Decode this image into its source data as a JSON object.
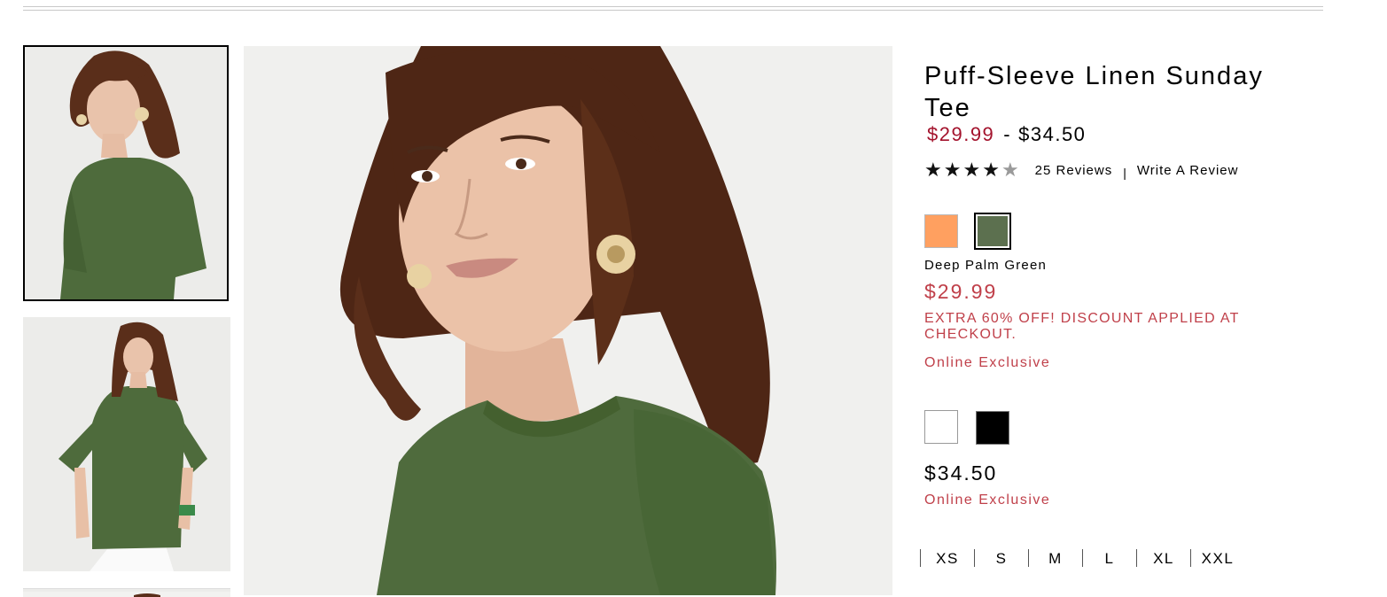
{
  "product": {
    "title": "Puff-Sleeve Linen Sunday Tee",
    "price_low": "$29.99",
    "price_dash": "-",
    "price_high": "$34.50",
    "rating": {
      "stars": 4,
      "max": 5
    },
    "reviews_label": "25 Reviews",
    "separator": "|",
    "write_review_label": "Write A Review"
  },
  "gallery": {
    "thumbnails": [
      "model-closeup",
      "model-full-body",
      "model-partial"
    ],
    "main": "model-closeup-large"
  },
  "variant_group_1": {
    "swatches": [
      {
        "name": "orange-swatch",
        "color": "#ffa060"
      },
      {
        "name": "green-swatch",
        "color": "#5c704f",
        "selected": true
      }
    ],
    "selected_color_name": "Deep Palm Green",
    "price": "$29.99",
    "promo": "EXTRA 60% OFF! DISCOUNT APPLIED AT CHECKOUT.",
    "badge": "Online Exclusive"
  },
  "variant_group_2": {
    "swatches": [
      {
        "name": "white-swatch",
        "color": "#ffffff"
      },
      {
        "name": "black-swatch",
        "color": "#000000"
      }
    ],
    "price": "$34.50",
    "badge": "Online Exclusive"
  },
  "sizes": [
    "XS",
    "S",
    "M",
    "L",
    "XL",
    "XXL"
  ],
  "colors": {
    "sale_red": "#a3122c",
    "promo_red": "#c0404a",
    "text": "#000000"
  }
}
